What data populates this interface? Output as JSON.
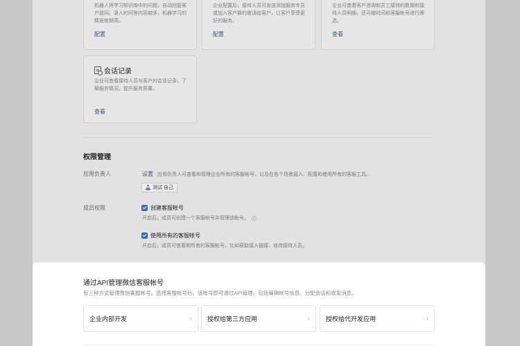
{
  "cards_top": [
    {
      "desc": "机器人将学习知识库中的问题，自动回复客户提问。录入的问答内容越多，机器学习的精准度越高。",
      "action": "配置"
    },
    {
      "desc": "企业配置后，接待人员可发送添加服务专员或加入客户群的邀请给客户，让客户享受更好的服务。",
      "action": "配置"
    },
    {
      "desc": "企业可查看客户咨询和员工接待的数据和接待人员明细，还可按时间和客服帐号进行筛选。",
      "action": "查看"
    }
  ],
  "session_card": {
    "icon": "doc-search-icon",
    "title": "会话记录",
    "desc": "企业可查看接待人员与客户的会话记录，了解服务情况，提升服务质量。",
    "action": "查看"
  },
  "permissions": {
    "title": "权限管理",
    "owner_label": "应用负责人",
    "owner_link": "设置",
    "owner_desc": "应用负责人可查看和管理企业所有的客服帐号，以及在各个场景接入、配置和使用所有的客服工具。",
    "owner_tag": "测试 自己",
    "member_label": "成员权限",
    "perm1_label": "创建客服帐号",
    "perm1_desc": "开启后，成员可创建一个客服帐号并管理该帐号。",
    "perm2_label": "使用所有的客服帐号",
    "perm2_desc": "开启后，成员可查看和所有的客服帐号，比如获取接入链接、修改接待人员。"
  },
  "api_sheet": {
    "title": "通过API管理微信客服帐号",
    "desc": "有三种方式管理微信客服帐号。选择客服帐号后，该帐号即可通过API管理，包括编辑帐号信息、分配会话和收发消息。",
    "options": [
      {
        "label": "企业内部开发"
      },
      {
        "label": "授权给第三方应用"
      },
      {
        "label": "授权给代开发应用"
      }
    ]
  },
  "colors": {
    "accent": "#3a6db0",
    "link": "#35588a"
  }
}
